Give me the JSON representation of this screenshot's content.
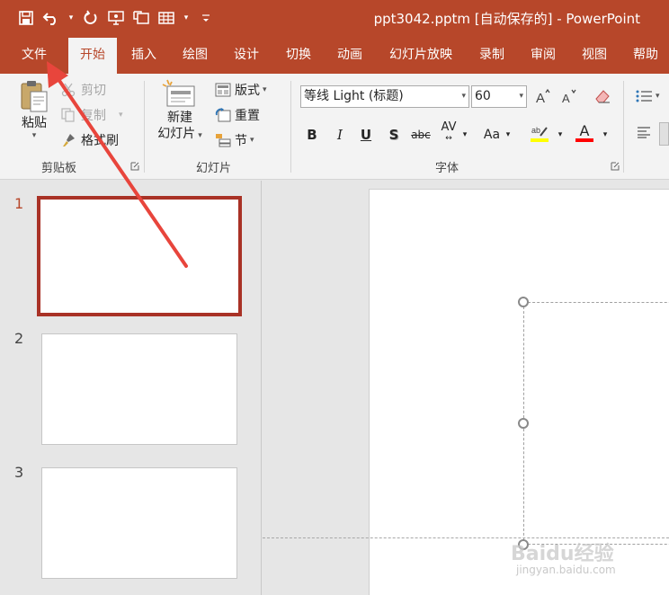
{
  "app": {
    "title": "ppt3042.pptm [自动保存的]  -  PowerPoint",
    "accent_color": "#b7472a",
    "qat_icons": [
      "save-icon",
      "undo-icon",
      "redo-icon",
      "presentation-icon",
      "slideshow-icon",
      "table-icon",
      "customize-icon"
    ]
  },
  "tabs": [
    {
      "label": "文件",
      "active": false
    },
    {
      "label": "开始",
      "active": true
    },
    {
      "label": "插入",
      "active": false
    },
    {
      "label": "绘图",
      "active": false
    },
    {
      "label": "设计",
      "active": false
    },
    {
      "label": "切换",
      "active": false
    },
    {
      "label": "动画",
      "active": false
    },
    {
      "label": "幻灯片放映",
      "active": false
    },
    {
      "label": "录制",
      "active": false
    },
    {
      "label": "审阅",
      "active": false
    },
    {
      "label": "视图",
      "active": false
    },
    {
      "label": "帮助",
      "active": false
    }
  ],
  "ribbon": {
    "clipboard": {
      "group_label": "剪贴板",
      "paste": "粘贴",
      "cut": "剪切",
      "copy": "复制",
      "format_painter": "格式刷"
    },
    "slides": {
      "group_label": "幻灯片",
      "new_slide_line1": "新建",
      "new_slide_line2": "幻灯片",
      "layout": "版式",
      "reset": "重置",
      "section": "节"
    },
    "font": {
      "group_label": "字体",
      "font_name": "等线 Light (标题)",
      "font_size": "60",
      "bold": "B",
      "italic": "I",
      "underline": "U",
      "shadow": "S",
      "strike": "abc",
      "spacing": "AV",
      "case": "Aa",
      "highlight_color": "#ffff00",
      "font_color": "#ff0000"
    }
  },
  "slides_panel": {
    "slides": [
      {
        "number": "1",
        "selected": true
      },
      {
        "number": "2",
        "selected": false
      },
      {
        "number": "3",
        "selected": false
      }
    ]
  },
  "watermark": {
    "text": "Baidu经验",
    "sub": "jingyan.baidu.com"
  }
}
